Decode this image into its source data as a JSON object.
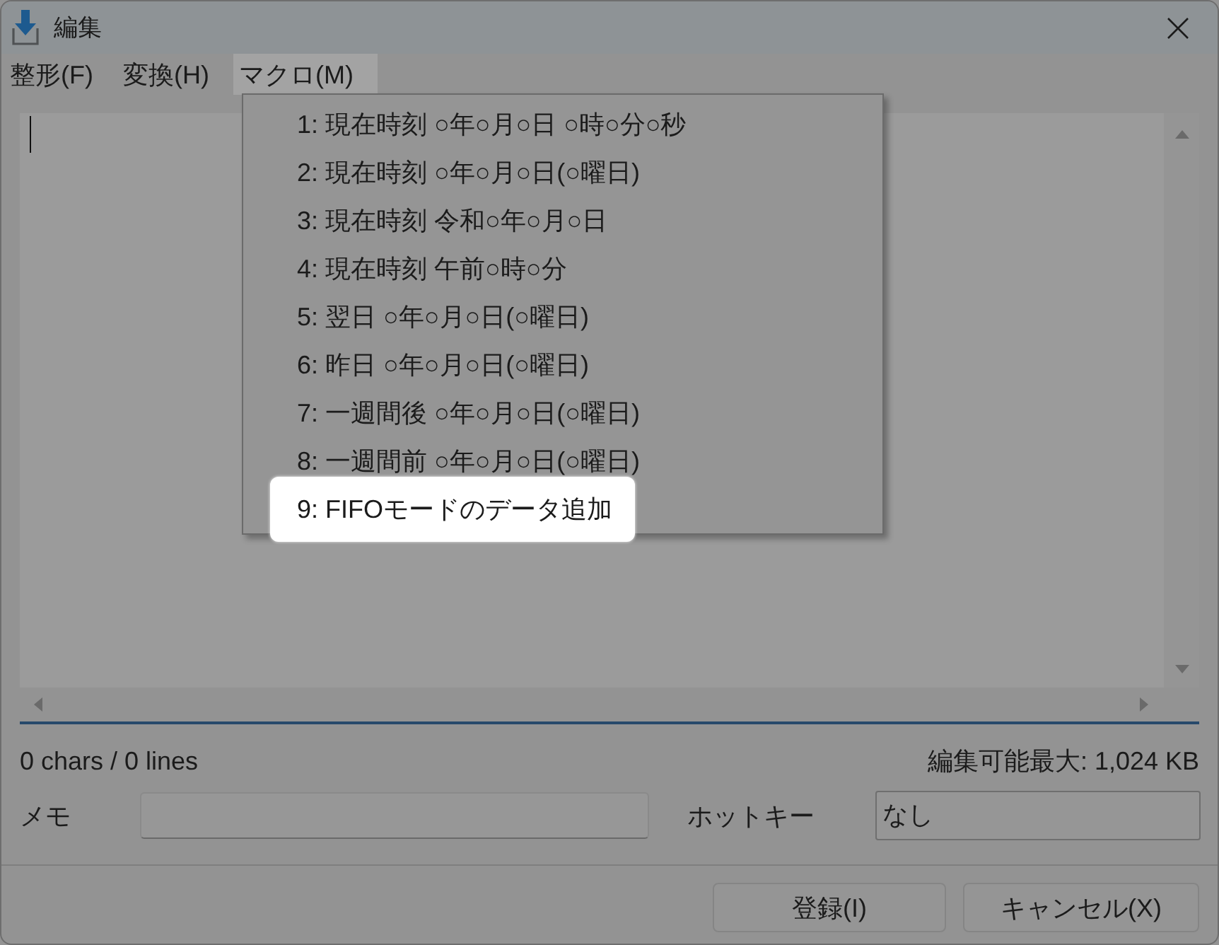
{
  "window": {
    "title": "編集"
  },
  "menu_bar": [
    {
      "label": "整形(F)",
      "selected": false
    },
    {
      "label": "変換(H)",
      "selected": false
    },
    {
      "label": "マクロ(M)",
      "selected": true
    }
  ],
  "dropdown_menu": {
    "items": [
      {
        "label": "1: 現在時刻 ○年○月○日 ○時○分○秒",
        "selected": false
      },
      {
        "label": "2: 現在時刻 ○年○月○日(○曜日)",
        "selected": false
      },
      {
        "label": "3: 現在時刻 令和○年○月○日",
        "selected": false
      },
      {
        "label": "4: 現在時刻 午前○時○分",
        "selected": false
      },
      {
        "label": "5: 翌日 ○年○月○日(○曜日)",
        "selected": false
      },
      {
        "label": "6: 昨日 ○年○月○日(○曜日)",
        "selected": false
      },
      {
        "label": "7: 一週間後 ○年○月○日(○曜日)",
        "selected": false
      },
      {
        "label": "8: 一週間前 ○年○月○日(○曜日)",
        "selected": false
      },
      {
        "label": "9: FIFOモードのデータ追加",
        "selected": true
      }
    ]
  },
  "status": {
    "counts": "0 chars / 0 lines",
    "limit": "編集可能最大: 1,024 KB"
  },
  "fields": [
    {
      "label": "メモ"
    },
    {
      "label": "ホットキー",
      "value": "なし"
    }
  ],
  "buttons": [
    "登録(I)",
    "キャンセル(X)"
  ]
}
